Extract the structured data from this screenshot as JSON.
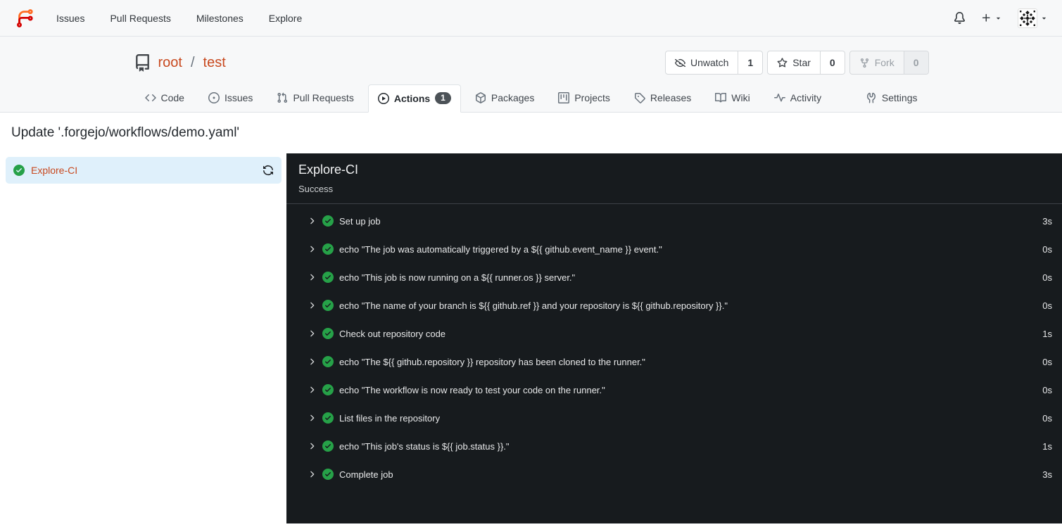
{
  "navbar": {
    "items": [
      {
        "label": "Issues"
      },
      {
        "label": "Pull Requests"
      },
      {
        "label": "Milestones"
      },
      {
        "label": "Explore"
      }
    ]
  },
  "repo": {
    "owner": "root",
    "separator": "/",
    "name": "test",
    "actions": [
      {
        "label": "Unwatch",
        "count": "1"
      },
      {
        "label": "Star",
        "count": "0"
      },
      {
        "label": "Fork",
        "count": "0"
      }
    ]
  },
  "tabs": [
    {
      "label": "Code"
    },
    {
      "label": "Issues"
    },
    {
      "label": "Pull Requests"
    },
    {
      "label": "Actions",
      "badge": "1"
    },
    {
      "label": "Packages"
    },
    {
      "label": "Projects"
    },
    {
      "label": "Releases"
    },
    {
      "label": "Wiki"
    },
    {
      "label": "Activity"
    },
    {
      "label": "Settings"
    }
  ],
  "run": {
    "title": "Update '.forgejo/workflows/demo.yaml'"
  },
  "sidebar": {
    "job": {
      "name": "Explore-CI"
    }
  },
  "panel": {
    "title": "Explore-CI",
    "status": "Success",
    "steps": [
      {
        "name": "Set up job",
        "duration": "3s"
      },
      {
        "name": "echo \"The job was automatically triggered by a ${{ github.event_name }} event.\"",
        "duration": "0s"
      },
      {
        "name": "echo \"This job is now running on a ${{ runner.os }} server.\"",
        "duration": "0s"
      },
      {
        "name": "echo \"The name of your branch is ${{ github.ref }} and your repository is ${{ github.repository }}.\"",
        "duration": "0s"
      },
      {
        "name": "Check out repository code",
        "duration": "1s"
      },
      {
        "name": "echo \"The ${{ github.repository }} repository has been cloned to the runner.\"",
        "duration": "0s"
      },
      {
        "name": "echo \"The workflow is now ready to test your code on the runner.\"",
        "duration": "0s"
      },
      {
        "name": "List files in the repository",
        "duration": "0s"
      },
      {
        "name": "echo \"This job's status is ${{ job.status }}.\"",
        "duration": "1s"
      },
      {
        "name": "Complete job",
        "duration": "3s"
      }
    ]
  },
  "colors": {
    "accent_link": "#c8491f",
    "success_green": "#26a148",
    "panel_bg": "#171b1e",
    "sidebar_selected_bg": "#dff0fb",
    "badge_bg": "#4c5257"
  }
}
